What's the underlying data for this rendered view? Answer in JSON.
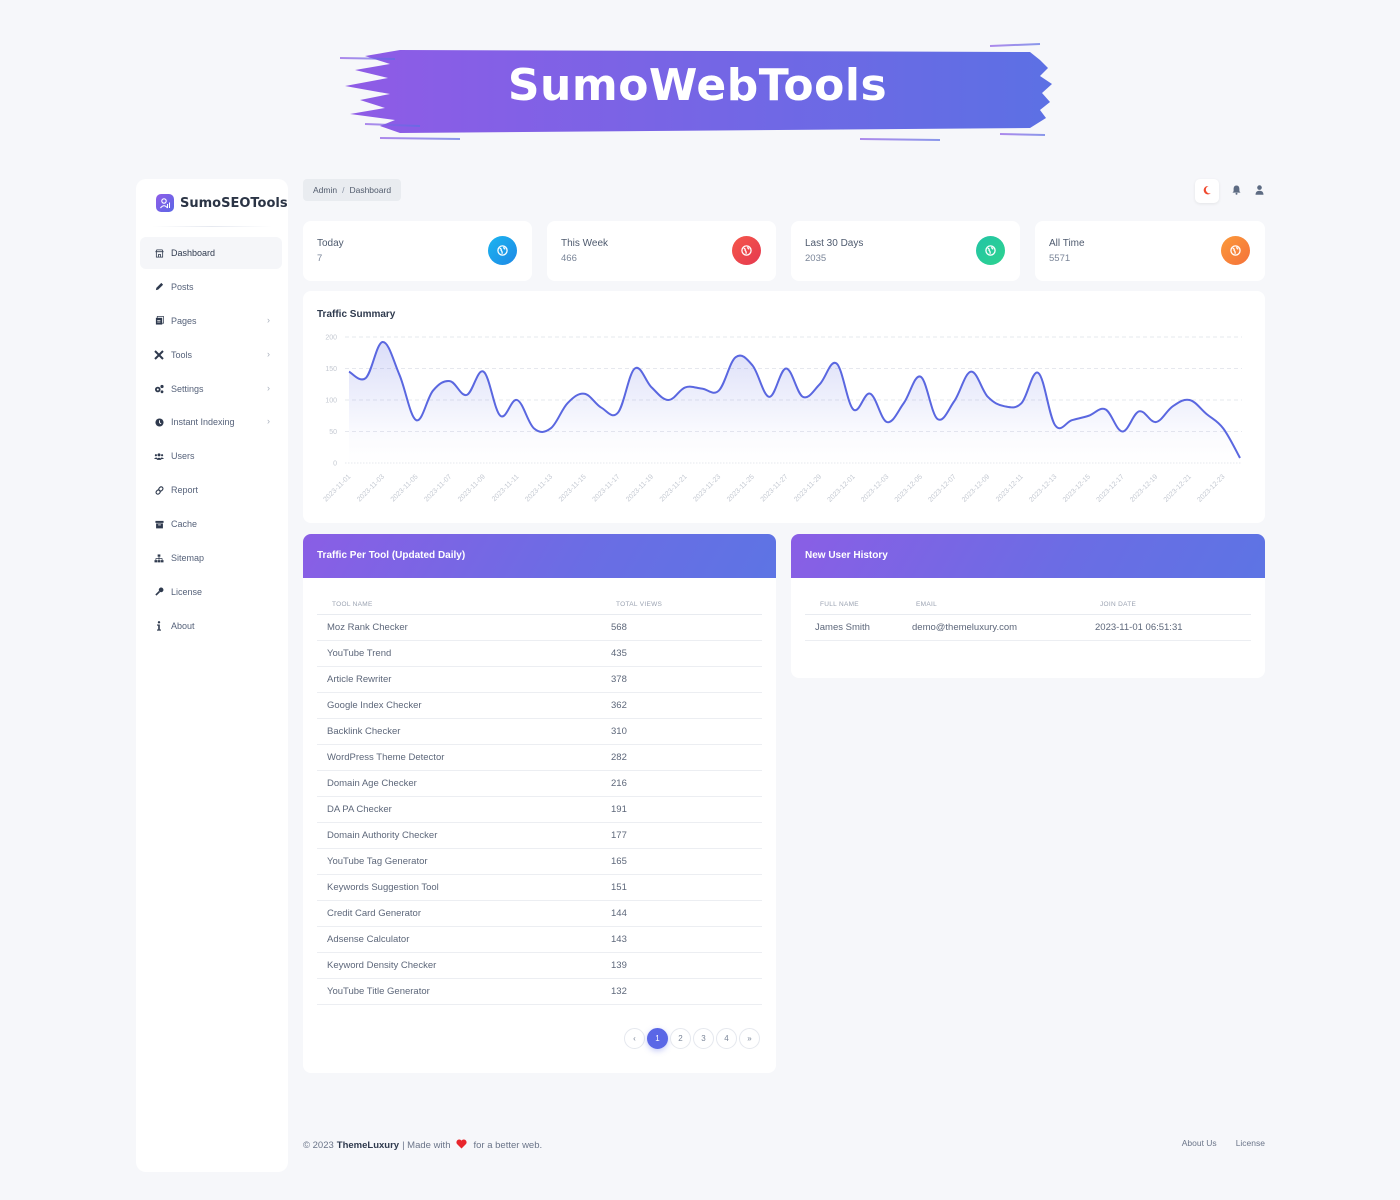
{
  "banner": {
    "title": "SumoWebTools",
    "gradient_start": "#8f5be6",
    "gradient_end": "#5c70e4"
  },
  "sidebar": {
    "brand": "SumoSEOTools",
    "items": [
      {
        "label": "Dashboard",
        "icon": "dashboard-icon",
        "active": true,
        "has_submenu": false
      },
      {
        "label": "Posts",
        "icon": "pencil-icon",
        "active": false,
        "has_submenu": false
      },
      {
        "label": "Pages",
        "icon": "pages-icon",
        "active": false,
        "has_submenu": true
      },
      {
        "label": "Tools",
        "icon": "tools-icon",
        "active": false,
        "has_submenu": true
      },
      {
        "label": "Settings",
        "icon": "gears-icon",
        "active": false,
        "has_submenu": true
      },
      {
        "label": "Instant Indexing",
        "icon": "clock-icon",
        "active": false,
        "has_submenu": true
      },
      {
        "label": "Users",
        "icon": "users-icon",
        "active": false,
        "has_submenu": false
      },
      {
        "label": "Report",
        "icon": "link-icon",
        "active": false,
        "has_submenu": false
      },
      {
        "label": "Cache",
        "icon": "archive-icon",
        "active": false,
        "has_submenu": false
      },
      {
        "label": "Sitemap",
        "icon": "sitemap-icon",
        "active": false,
        "has_submenu": false
      },
      {
        "label": "License",
        "icon": "key-icon",
        "active": false,
        "has_submenu": false
      },
      {
        "label": "About",
        "icon": "info-icon",
        "active": false,
        "has_submenu": false
      }
    ]
  },
  "breadcrumb": {
    "root": "Admin",
    "separator": "/",
    "current": "Dashboard"
  },
  "topbar": {
    "icons": [
      "moon-icon",
      "bell-icon",
      "user-icon"
    ]
  },
  "stats": [
    {
      "label": "Today",
      "value": "7",
      "color_start": "#1cb5f0",
      "color_end": "#1e88e5"
    },
    {
      "label": "This Week",
      "value": "466",
      "color_start": "#f5574a",
      "color_end": "#e53950"
    },
    {
      "label": "Last 30 Days",
      "value": "2035",
      "color_start": "#23c4a6",
      "color_end": "#2dd38f"
    },
    {
      "label": "All Time",
      "value": "5571",
      "color_start": "#fb9a3a",
      "color_end": "#f5713a"
    }
  ],
  "chart_data": {
    "type": "area",
    "title": "Traffic Summary",
    "xlabel": "",
    "ylabel": "",
    "ylim": [
      0,
      200
    ],
    "yticks": [
      0,
      50,
      100,
      150,
      200
    ],
    "grid": true,
    "line_color": "#5a67e0",
    "x": [
      "2023-11-01",
      "2023-11-02",
      "2023-11-03",
      "2023-11-04",
      "2023-11-05",
      "2023-11-06",
      "2023-11-07",
      "2023-11-08",
      "2023-11-09",
      "2023-11-10",
      "2023-11-11",
      "2023-11-12",
      "2023-11-13",
      "2023-11-14",
      "2023-11-15",
      "2023-11-16",
      "2023-11-17",
      "2023-11-18",
      "2023-11-19",
      "2023-11-20",
      "2023-11-21",
      "2023-11-22",
      "2023-11-23",
      "2023-11-24",
      "2023-11-25",
      "2023-11-26",
      "2023-11-27",
      "2023-11-28",
      "2023-11-29",
      "2023-11-30",
      "2023-12-01",
      "2023-12-02",
      "2023-12-03",
      "2023-12-04",
      "2023-12-05",
      "2023-12-06",
      "2023-12-07",
      "2023-12-08",
      "2023-12-09",
      "2023-12-10",
      "2023-12-11",
      "2023-12-12",
      "2023-12-13",
      "2023-12-14",
      "2023-12-15",
      "2023-12-16",
      "2023-12-17",
      "2023-12-18",
      "2023-12-19",
      "2023-12-20",
      "2023-12-21",
      "2023-12-22",
      "2023-12-23",
      "2023-12-24"
    ],
    "xtick_labels": [
      "2023-11-01",
      "2023-11-03",
      "2023-11-05",
      "2023-11-07",
      "2023-11-09",
      "2023-11-11",
      "2023-11-13",
      "2023-11-15",
      "2023-11-17",
      "2023-11-19",
      "2023-11-21",
      "2023-11-23",
      "2023-11-25",
      "2023-11-27",
      "2023-11-29",
      "2023-12-01",
      "2023-12-03",
      "2023-12-05",
      "2023-12-07",
      "2023-12-09",
      "2023-12-11",
      "2023-12-13",
      "2023-12-15",
      "2023-12-17",
      "2023-12-19",
      "2023-12-21",
      "2023-12-23"
    ],
    "series": [
      {
        "name": "Traffic",
        "values": [
          145,
          135,
          192,
          140,
          68,
          115,
          130,
          108,
          145,
          75,
          100,
          55,
          55,
          95,
          110,
          88,
          80,
          150,
          120,
          100,
          120,
          118,
          115,
          168,
          155,
          105,
          150,
          105,
          125,
          158,
          85,
          110,
          65,
          95,
          137,
          70,
          98,
          145,
          105,
          90,
          95,
          143,
          60,
          68,
          75,
          85,
          50,
          82,
          65,
          90,
          100,
          78,
          55,
          8
        ]
      }
    ]
  },
  "traffic_table": {
    "title": "Traffic Per Tool (Updated Daily)",
    "columns": [
      "TOOL NAME",
      "TOTAL VIEWS"
    ],
    "rows": [
      [
        "Moz Rank Checker",
        "568"
      ],
      [
        "YouTube Trend",
        "435"
      ],
      [
        "Article Rewriter",
        "378"
      ],
      [
        "Google Index Checker",
        "362"
      ],
      [
        "Backlink Checker",
        "310"
      ],
      [
        "WordPress Theme Detector",
        "282"
      ],
      [
        "Domain Age Checker",
        "216"
      ],
      [
        "DA PA Checker",
        "191"
      ],
      [
        "Domain Authority Checker",
        "177"
      ],
      [
        "YouTube Tag Generator",
        "165"
      ],
      [
        "Keywords Suggestion Tool",
        "151"
      ],
      [
        "Credit Card Generator",
        "144"
      ],
      [
        "Adsense Calculator",
        "143"
      ],
      [
        "Keyword Density Checker",
        "139"
      ],
      [
        "YouTube Title Generator",
        "132"
      ]
    ],
    "pagination": {
      "prev": "‹",
      "pages": [
        "1",
        "2",
        "3",
        "4"
      ],
      "current": "1",
      "next": "»"
    }
  },
  "user_table": {
    "title": "New User History",
    "columns": [
      "FULL NAME",
      "EMAIL",
      "JOIN DATE"
    ],
    "rows": [
      [
        "James Smith",
        "demo@themeluxury.com",
        "2023-11-01 06:51:31"
      ]
    ]
  },
  "footer": {
    "copyright": "© 2023",
    "brand": "ThemeLuxury",
    "made_with": "| Made with",
    "tail": "for a better web.",
    "links": [
      "About Us",
      "License"
    ]
  }
}
